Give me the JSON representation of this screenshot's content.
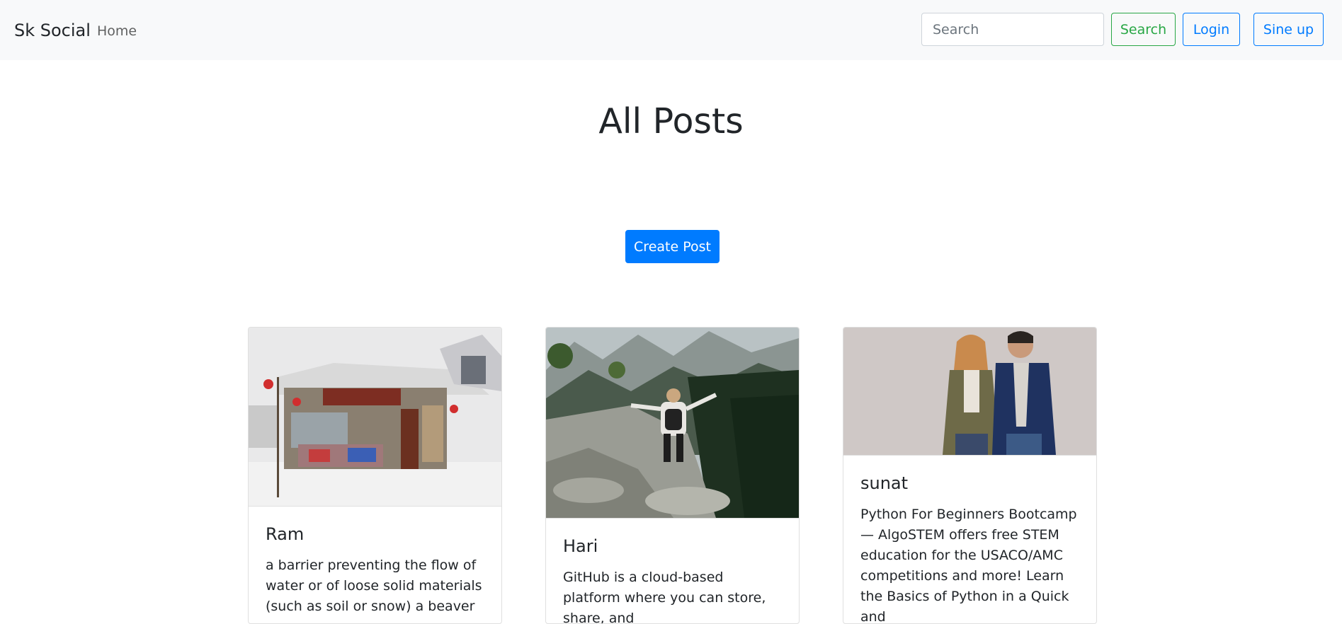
{
  "navbar": {
    "brand": "Sk Social",
    "home_link": "Home",
    "search_placeholder": "Search",
    "search_button": "Search",
    "login_button": "Login",
    "signup_button": "Sine up"
  },
  "main": {
    "title": "All Posts",
    "create_button": "Create Post"
  },
  "posts": [
    {
      "author": "Ram",
      "image_icon": "snowy-shop-photo",
      "text": "a barrier preventing the flow of water or of loose solid materials (such as soil or snow) a beaver"
    },
    {
      "author": "Hari",
      "image_icon": "mountain-hiker-photo",
      "text": "GitHub is a cloud-based platform where you can store, share, and"
    },
    {
      "author": "sunat",
      "image_icon": "fashion-couple-photo",
      "text": "Python For Beginners Bootcamp — AlgoSTEM offers free STEM education for the USACO/AMC competitions and more! Learn the Basics of Python in a Quick and"
    }
  ],
  "colors": {
    "navbar_bg": "#f8f9fa",
    "primary": "#007bff",
    "success": "#28a745",
    "text": "#212529"
  }
}
